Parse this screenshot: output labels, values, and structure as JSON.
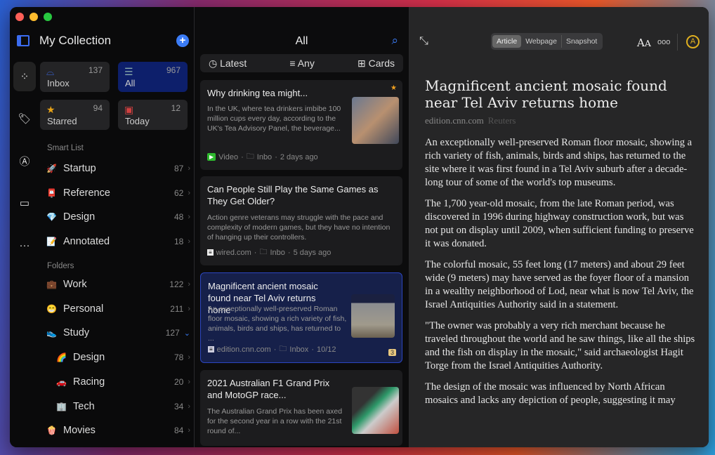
{
  "sidebar": {
    "title": "My Collection",
    "tiles": [
      {
        "label": "Inbox",
        "count": "137"
      },
      {
        "label": "All",
        "count": "967"
      },
      {
        "label": "Starred",
        "count": "94"
      },
      {
        "label": "Today",
        "count": "12"
      }
    ],
    "smart_list_header": "Smart List",
    "smart_list": [
      {
        "emoji": "🚀",
        "label": "Startup",
        "count": "87"
      },
      {
        "emoji": "📮",
        "label": "Reference",
        "count": "62"
      },
      {
        "emoji": "💎",
        "label": "Design",
        "count": "48"
      },
      {
        "emoji": "📝",
        "label": "Annotated",
        "count": "18"
      }
    ],
    "folders_header": "Folders",
    "folders": [
      {
        "emoji": "💼",
        "label": "Work",
        "count": "122"
      },
      {
        "emoji": "😁",
        "label": "Personal",
        "count": "211"
      },
      {
        "emoji": "👟",
        "label": "Study",
        "count": "127"
      },
      {
        "emoji": "🌈",
        "label": "Design",
        "count": "78"
      },
      {
        "emoji": "🚗",
        "label": "Racing",
        "count": "20"
      },
      {
        "emoji": "🏢",
        "label": "Tech",
        "count": "34"
      },
      {
        "emoji": "🍿",
        "label": "Movies",
        "count": "84"
      }
    ]
  },
  "list": {
    "title": "All",
    "filters": [
      "Latest",
      "Any",
      "Cards"
    ],
    "cards": [
      {
        "title": "Why drinking tea might...",
        "excerpt": "In the UK, where tea drinkers imbibe 100 million cups every day, according to the UK's Tea Advisory Panel, the beverage...",
        "source": "Video",
        "folder": "Inbo",
        "time": "2 days ago"
      },
      {
        "title": "Can People Still Play the Same Games as They Get Older?",
        "excerpt": "Action genre veterans may struggle with the pace and complexity of modern games, but they have no intention of hanging up their controllers.",
        "source": "wired.com",
        "folder": "Inbo",
        "time": "5 days ago"
      },
      {
        "title": "Magnificent ancient mosaic found near Tel Aviv returns home",
        "excerpt": "An exceptionally well-preserved Roman floor mosaic, showing a rich variety of fish, animals, birds and ships, has returned to ...",
        "source": "edition.cnn.com",
        "folder": "Inbox",
        "time": "10/12",
        "badge": "3"
      },
      {
        "title": "2021 Australian F1 Grand Prix and MotoGP race...",
        "excerpt": "The Australian Grand Prix has been axed for the second year in a row with the 21st round of..."
      }
    ]
  },
  "reader": {
    "tabs": [
      "Article",
      "Webpage",
      "Snapshot"
    ],
    "title": "Magnificent ancient mosaic found near Tel Aviv returns home",
    "source": "edition.cnn.com",
    "author": "Reuters",
    "paragraphs": [
      "An exceptionally well-preserved Roman floor mosaic, showing a rich variety of fish, animals, birds and ships, has returned to the site where it was first found in a Tel Aviv suburb after a decade-long tour of some of the world's top museums.",
      "The 1,700 year-old mosaic, from the late Roman period, was discovered in 1996 during highway construction work, but was not put on display until 2009, when sufficient funding to preserve it was donated.",
      "The colorful mosaic, 55 feet long (17 meters) and about 29 feet wide (9 meters) may have served as the foyer floor of a mansion in a wealthy neighborhood of Lod, near what is now Tel Aviv, the Israel Antiquities Authority said in a statement.",
      "\"The owner was probably a very rich merchant because he traveled throughout the world and he saw things, like all the ships and the fish on display in the mosaic,\" said archaeologist Hagit Torge from the Israel Antiquities Authority.",
      "The design of the mosaic was influenced by North African mosaics and lacks any depiction of people, suggesting it may"
    ]
  }
}
